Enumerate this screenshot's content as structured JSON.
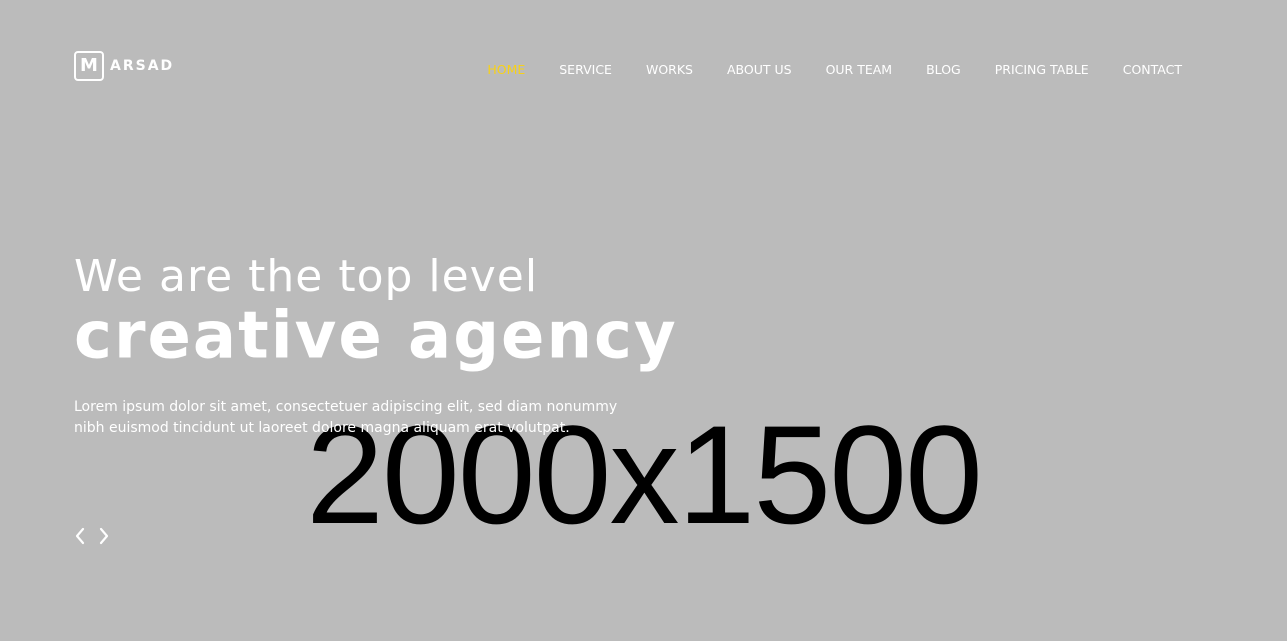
{
  "logo": {
    "mark": "M",
    "name": "ARSAD"
  },
  "nav": {
    "items": [
      {
        "label": "HOME"
      },
      {
        "label": "SERVICE"
      },
      {
        "label": "WORKS"
      },
      {
        "label": "ABOUT US"
      },
      {
        "label": "OUR TEAM"
      },
      {
        "label": "BLOG"
      },
      {
        "label": "PRICING TABLE"
      },
      {
        "label": "CONTACT"
      }
    ],
    "active_item": "HOME"
  },
  "hero": {
    "subtitle": "We are the top level",
    "title": "creative agency",
    "description": "Lorem ipsum dolor sit amet, consectetuer adipiscing elit, sed diam nonummy nibh euismod tincidunt ut laoreet dolore magna aliquam erat volutpat."
  },
  "background": {
    "placeholder": "2000x1500",
    "color": "#bbbbbb"
  },
  "slider": {
    "prev_icon": "chevron-left-icon",
    "next_icon": "chevron-right-icon"
  },
  "colors": {
    "accent": "#f7d118",
    "text": "#ffffff",
    "placeholder_text": "#000000"
  }
}
